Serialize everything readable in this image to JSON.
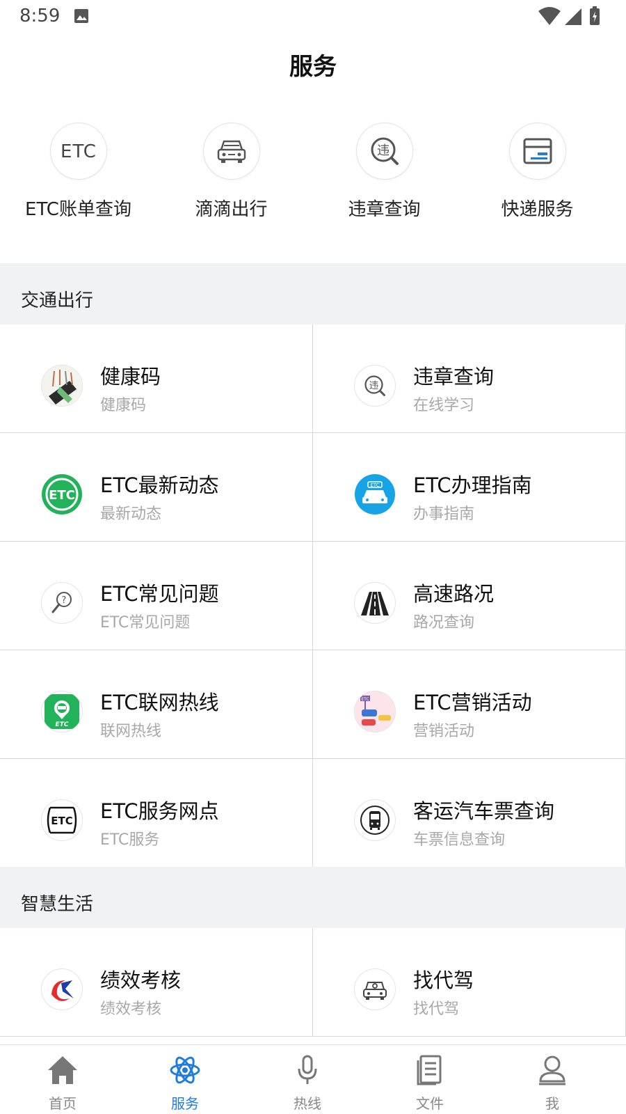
{
  "status_bar": {
    "time": "8:59"
  },
  "header": {
    "title": "服务"
  },
  "quick_actions": [
    {
      "label": "ETC账单查询",
      "icon": "etc-icon"
    },
    {
      "label": "滴滴出行",
      "icon": "car-icon"
    },
    {
      "label": "违章查询",
      "icon": "violation-search-icon"
    },
    {
      "label": "快递服务",
      "icon": "package-icon"
    }
  ],
  "sections": [
    {
      "title": "交通出行",
      "items": [
        {
          "title": "健康码",
          "subtitle": "健康码",
          "icon": "health-code-icon"
        },
        {
          "title": "违章查询",
          "subtitle": "在线学习",
          "icon": "violation-search-icon"
        },
        {
          "title": "ETC最新动态",
          "subtitle": "最新动态",
          "icon": "etc-green-icon"
        },
        {
          "title": "ETC办理指南",
          "subtitle": "办事指南",
          "icon": "etc-car-blue-icon"
        },
        {
          "title": "ETC常见问题",
          "subtitle": "ETC常见问题",
          "icon": "question-search-icon"
        },
        {
          "title": "高速路况",
          "subtitle": "路况查询",
          "icon": "highway-icon"
        },
        {
          "title": "ETC联网热线",
          "subtitle": "联网热线",
          "icon": "etc-hotline-icon"
        },
        {
          "title": "ETC营销活动",
          "subtitle": "营销活动",
          "icon": "etc-promo-icon"
        },
        {
          "title": "ETC服务网点",
          "subtitle": "ETC服务",
          "icon": "etc-outlet-icon"
        },
        {
          "title": "客运汽车票查询",
          "subtitle": "车票信息查询",
          "icon": "bus-icon"
        }
      ]
    },
    {
      "title": "智慧生活",
      "items": [
        {
          "title": "绩效考核",
          "subtitle": "绩效考核",
          "icon": "performance-logo-icon"
        },
        {
          "title": "找代驾",
          "subtitle": "找代驾",
          "icon": "driver-icon"
        }
      ]
    }
  ],
  "bottom_nav": [
    {
      "label": "首页",
      "icon": "home-icon",
      "active": false
    },
    {
      "label": "服务",
      "icon": "atom-icon",
      "active": true
    },
    {
      "label": "热线",
      "icon": "microphone-icon",
      "active": false
    },
    {
      "label": "文件",
      "icon": "document-icon",
      "active": false
    },
    {
      "label": "我",
      "icon": "person-icon",
      "active": false
    }
  ],
  "colors": {
    "accent": "#1e7be0",
    "section_bg": "#f1f2f6",
    "subtitle": "#a8a8a8"
  }
}
